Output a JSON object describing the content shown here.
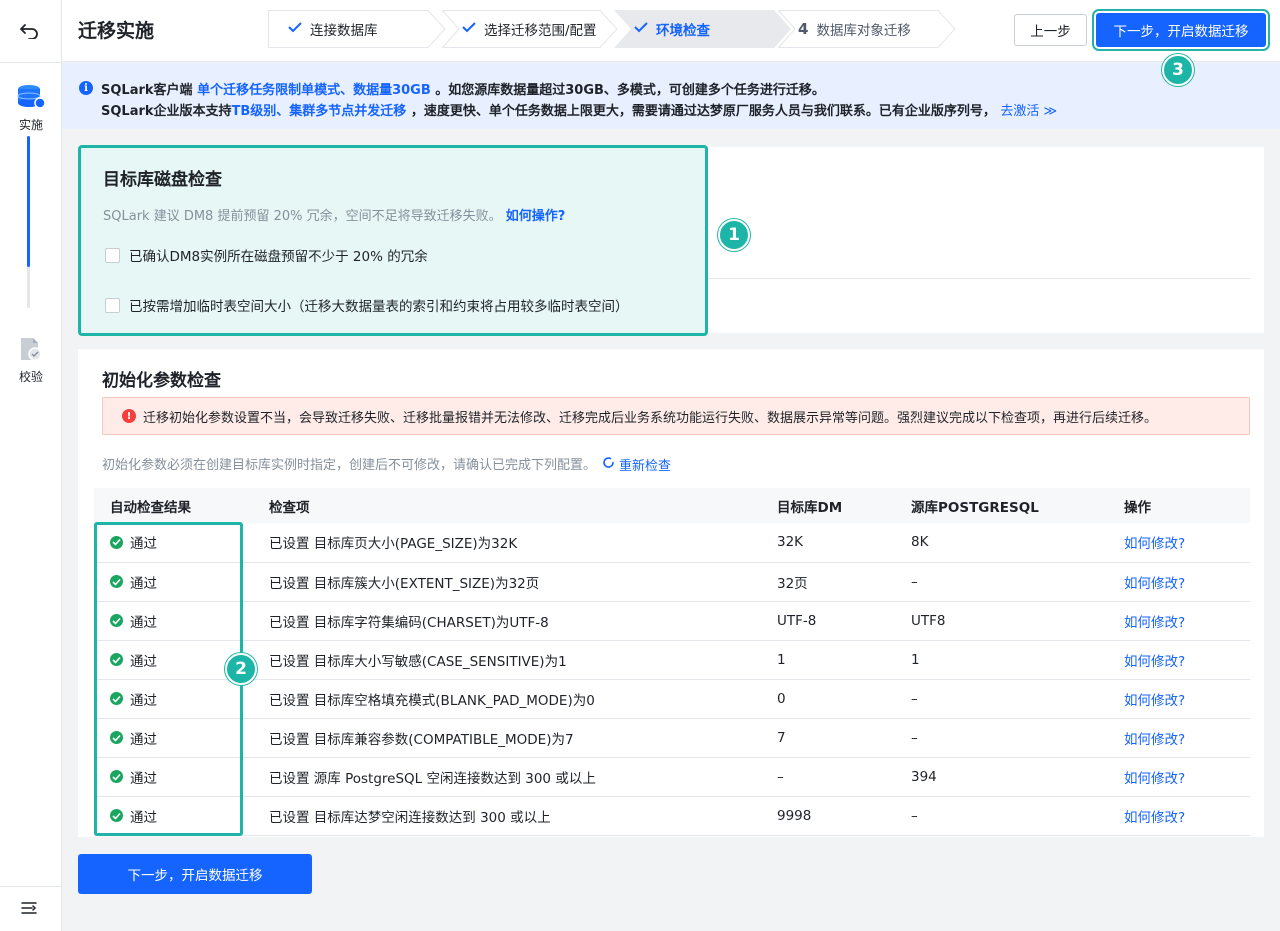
{
  "rail": {
    "items": [
      {
        "label": "实施",
        "icon": "database-icon"
      },
      {
        "label": "校验",
        "icon": "verify-document-icon"
      }
    ],
    "progress_fraction": 0.76
  },
  "header": {
    "title": "迁移实施",
    "steps": [
      {
        "label": "连接数据库",
        "state": "done"
      },
      {
        "label": "选择迁移范围/配置",
        "state": "done"
      },
      {
        "label": "环境检查",
        "state": "active"
      },
      {
        "number": "4",
        "label": "数据库对象迁移",
        "state": "pending"
      }
    ],
    "prev_label": "上一步",
    "next_label": "下一步，开启数据迁移"
  },
  "banner": {
    "line1_a": "SQLark客户端 ",
    "line1_hl": "单个迁移任务限制单模式、数据量30GB",
    "line1_b": " 。如您源库数据量超过30GB、多模式，可创建多个任务进行迁移。",
    "line2_a": "SQLark企业版本支持",
    "line2_hl": "TB级别、集群多节点并发迁移",
    "line2_b": " ，速度更快、单个任务数据上限更大，需要请通过达梦原厂服务人员与我们联系。已有企业版序列号，",
    "activate": "去激活 ≫"
  },
  "disk_check": {
    "title": "目标库磁盘检查",
    "hint": "SQLark 建议 DM8 提前预留 20% 冗余，空间不足将导致迁移失败。",
    "how_link": "如何操作?",
    "checks": [
      "已确认DM8实例所在磁盘预留不少于 20% 的冗余",
      "已按需增加临时表空间大小（迁移大数据量表的索引和约束将占用较多临时表空间）"
    ]
  },
  "init_check": {
    "title": "初始化参数检查",
    "alert": "迁移初始化参数设置不当，会导致迁移失败、迁移批量报错并无法修改、迁移完成后业务系统功能运行失败、数据展示异常等问题。强烈建议完成以下检查项，再进行后续迁移。",
    "hint": "初始化参数必须在创建目标库实例时指定，创建后不可修改，请确认已完成下列配置。",
    "recheck": "重新检查",
    "columns": [
      "自动检查结果",
      "检查项",
      "目标库DM",
      "源库POSTGRESQL",
      "操作"
    ],
    "rows": [
      {
        "result": "通过",
        "item": "已设置 目标库页大小(PAGE_SIZE)为32K",
        "target": "32K",
        "source": "8K",
        "action": "如何修改?"
      },
      {
        "result": "通过",
        "item": "已设置 目标库簇大小(EXTENT_SIZE)为32页",
        "target": "32页",
        "source": "–",
        "action": "如何修改?"
      },
      {
        "result": "通过",
        "item": "已设置 目标库字符集编码(CHARSET)为UTF-8",
        "target": "UTF-8",
        "source": "UTF8",
        "action": "如何修改?"
      },
      {
        "result": "通过",
        "item": "已设置 目标库大小写敏感(CASE_SENSITIVE)为1",
        "target": "1",
        "source": "1",
        "action": "如何修改?"
      },
      {
        "result": "通过",
        "item": "已设置 目标库空格填充模式(BLANK_PAD_MODE)为0",
        "target": "0",
        "source": "–",
        "action": "如何修改?"
      },
      {
        "result": "通过",
        "item": "已设置 目标库兼容参数(COMPATIBLE_MODE)为7",
        "target": "7",
        "source": "–",
        "action": "如何修改?"
      },
      {
        "result": "通过",
        "item": "已设置 源库 PostgreSQL 空闲连接数达到 300 或以上",
        "target": "–",
        "source": "394",
        "action": "如何修改?"
      },
      {
        "result": "通过",
        "item": "已设置 目标库达梦空闲连接数达到 300 或以上",
        "target": "9998",
        "source": "–",
        "action": "如何修改?"
      }
    ]
  },
  "footer": {
    "next_label": "下一步，开启数据迁移"
  },
  "callouts": [
    "1",
    "2",
    "3"
  ],
  "colors": {
    "primary": "#1664ff",
    "callout": "#1db5a7",
    "success": "#1aa661",
    "danger": "#f53f3f"
  }
}
